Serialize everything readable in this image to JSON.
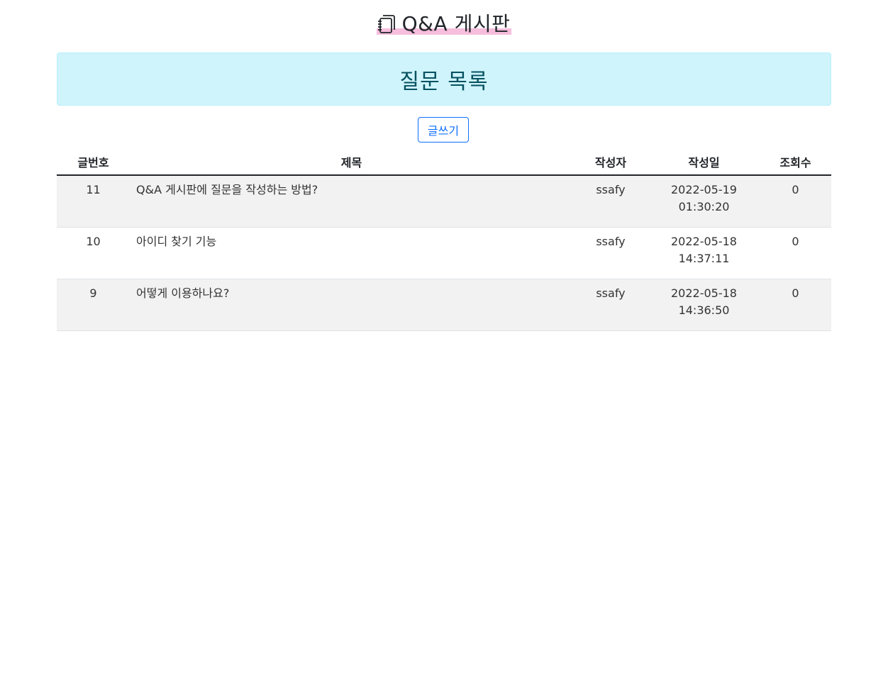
{
  "header": {
    "icon": "journals-icon",
    "title": "Q&A 게시판"
  },
  "banner": {
    "title": "질문 목록"
  },
  "toolbar": {
    "write_label": "글쓰기"
  },
  "table": {
    "columns": [
      "글번호",
      "제목",
      "작성자",
      "작성일",
      "조회수"
    ],
    "rows": [
      {
        "no": "11",
        "title": "Q&A 게시판에 질문을 작성하는 방법?",
        "writer": "ssafy",
        "date": "2022-05-19",
        "time": "01:30:20",
        "views": "0"
      },
      {
        "no": "10",
        "title": "아이디 찾기 기능",
        "writer": "ssafy",
        "date": "2022-05-18",
        "time": "14:37:11",
        "views": "0"
      },
      {
        "no": "9",
        "title": "어떻게 이용하나요?",
        "writer": "ssafy",
        "date": "2022-05-18",
        "time": "14:36:50",
        "views": "0"
      }
    ]
  },
  "colors": {
    "banner_bg": "#cff4fc",
    "banner_text": "#055160",
    "highlight": "#f6bddc",
    "primary": "#0d6efd",
    "stripe": "#f2f2f2"
  }
}
